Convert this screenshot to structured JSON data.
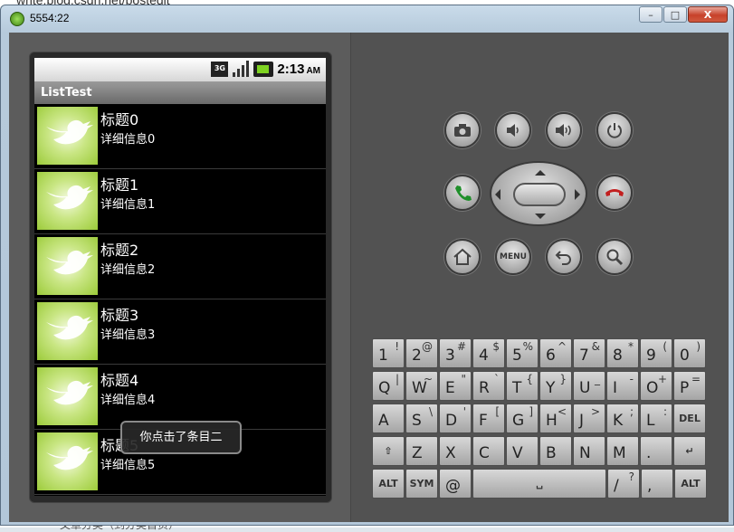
{
  "background": {
    "url_text": "write.blog.csdn.net/postedit",
    "bottom_text": "文章分类（到分类首页）"
  },
  "window": {
    "title": "5554:22",
    "minimize": "–",
    "maximize": "□",
    "close": "X"
  },
  "device": {
    "status_bar": {
      "network": "3G",
      "time": "2:13",
      "ampm": "AM"
    },
    "app_title": "ListTest",
    "list_items": [
      {
        "title": "标题0",
        "subtitle": "详细信息0"
      },
      {
        "title": "标题1",
        "subtitle": "详细信息1"
      },
      {
        "title": "标题2",
        "subtitle": "详细信息2"
      },
      {
        "title": "标题3",
        "subtitle": "详细信息3"
      },
      {
        "title": "标题4",
        "subtitle": "详细信息4"
      },
      {
        "title": "标题5",
        "subtitle": "详细信息5"
      }
    ],
    "toast": "你点击了条目二"
  },
  "controls": {
    "menu_label": "MENU"
  },
  "keyboard": {
    "rows": [
      [
        {
          "m": "1",
          "a": "!"
        },
        {
          "m": "2",
          "a": "@"
        },
        {
          "m": "3",
          "a": "#"
        },
        {
          "m": "4",
          "a": "$"
        },
        {
          "m": "5",
          "a": "%"
        },
        {
          "m": "6",
          "a": "^"
        },
        {
          "m": "7",
          "a": "&"
        },
        {
          "m": "8",
          "a": "*"
        },
        {
          "m": "9",
          "a": "("
        },
        {
          "m": "0",
          "a": ")"
        }
      ],
      [
        {
          "m": "Q",
          "a": "|"
        },
        {
          "m": "W",
          "a": "~"
        },
        {
          "m": "E",
          "a": "\""
        },
        {
          "m": "R",
          "a": "`"
        },
        {
          "m": "T",
          "a": "{"
        },
        {
          "m": "Y",
          "a": "}"
        },
        {
          "m": "U",
          "a": "_"
        },
        {
          "m": "I",
          "a": "-"
        },
        {
          "m": "O",
          "a": "+"
        },
        {
          "m": "P",
          "a": "="
        }
      ],
      [
        {
          "m": "A",
          "a": ""
        },
        {
          "m": "S",
          "a": "\\"
        },
        {
          "m": "D",
          "a": "'"
        },
        {
          "m": "F",
          "a": "["
        },
        {
          "m": "G",
          "a": "]"
        },
        {
          "m": "H",
          "a": "<"
        },
        {
          "m": "J",
          "a": ">"
        },
        {
          "m": "K",
          "a": ";"
        },
        {
          "m": "L",
          "a": ":"
        },
        {
          "m": "",
          "a": "",
          "c": "DEL"
        }
      ],
      [
        {
          "m": "",
          "a": "",
          "c": "⇧"
        },
        {
          "m": "Z",
          "a": ""
        },
        {
          "m": "X",
          "a": ""
        },
        {
          "m": "C",
          "a": ""
        },
        {
          "m": "V",
          "a": ""
        },
        {
          "m": "B",
          "a": ""
        },
        {
          "m": "N",
          "a": ""
        },
        {
          "m": "M",
          "a": ""
        },
        {
          "m": ".",
          "a": ""
        },
        {
          "m": "",
          "a": "",
          "c": "↵"
        }
      ]
    ],
    "bottom_row": {
      "alt_left": "ALT",
      "sym": "SYM",
      "at": "@",
      "space": "␣",
      "slash": "/",
      "slash_alt": "?",
      "comma": ",",
      "alt_right": "ALT"
    }
  }
}
